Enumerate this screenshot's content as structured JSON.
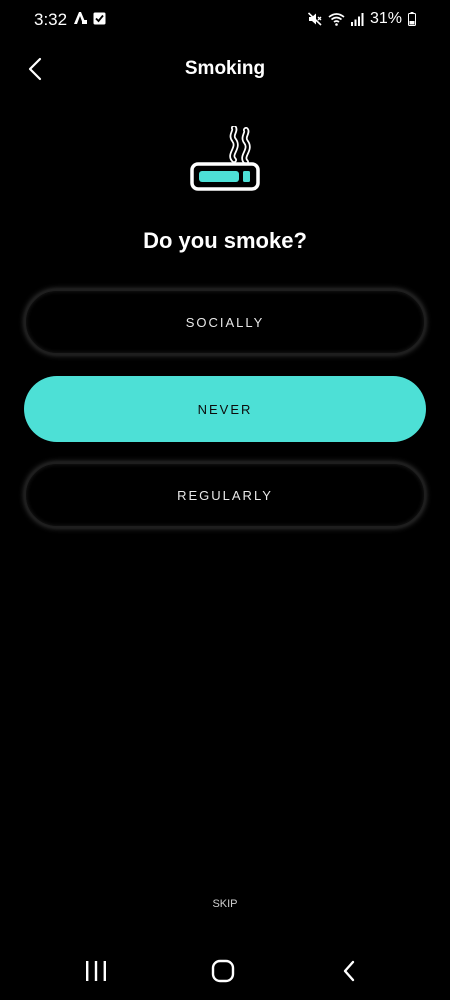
{
  "status_bar": {
    "time": "3:32",
    "battery": "31%"
  },
  "header": {
    "title": "Smoking"
  },
  "hero": {
    "icon": "cigarette-icon",
    "accent": "#4de0d6"
  },
  "question": "Do you smoke?",
  "options": [
    {
      "label": "SOCIALLY",
      "selected": false
    },
    {
      "label": "NEVER",
      "selected": true
    },
    {
      "label": "REGULARLY",
      "selected": false
    }
  ],
  "skip_label": "SKIP",
  "colors": {
    "background": "#000000",
    "accent": "#4de0d6",
    "text": "#ffffff"
  }
}
